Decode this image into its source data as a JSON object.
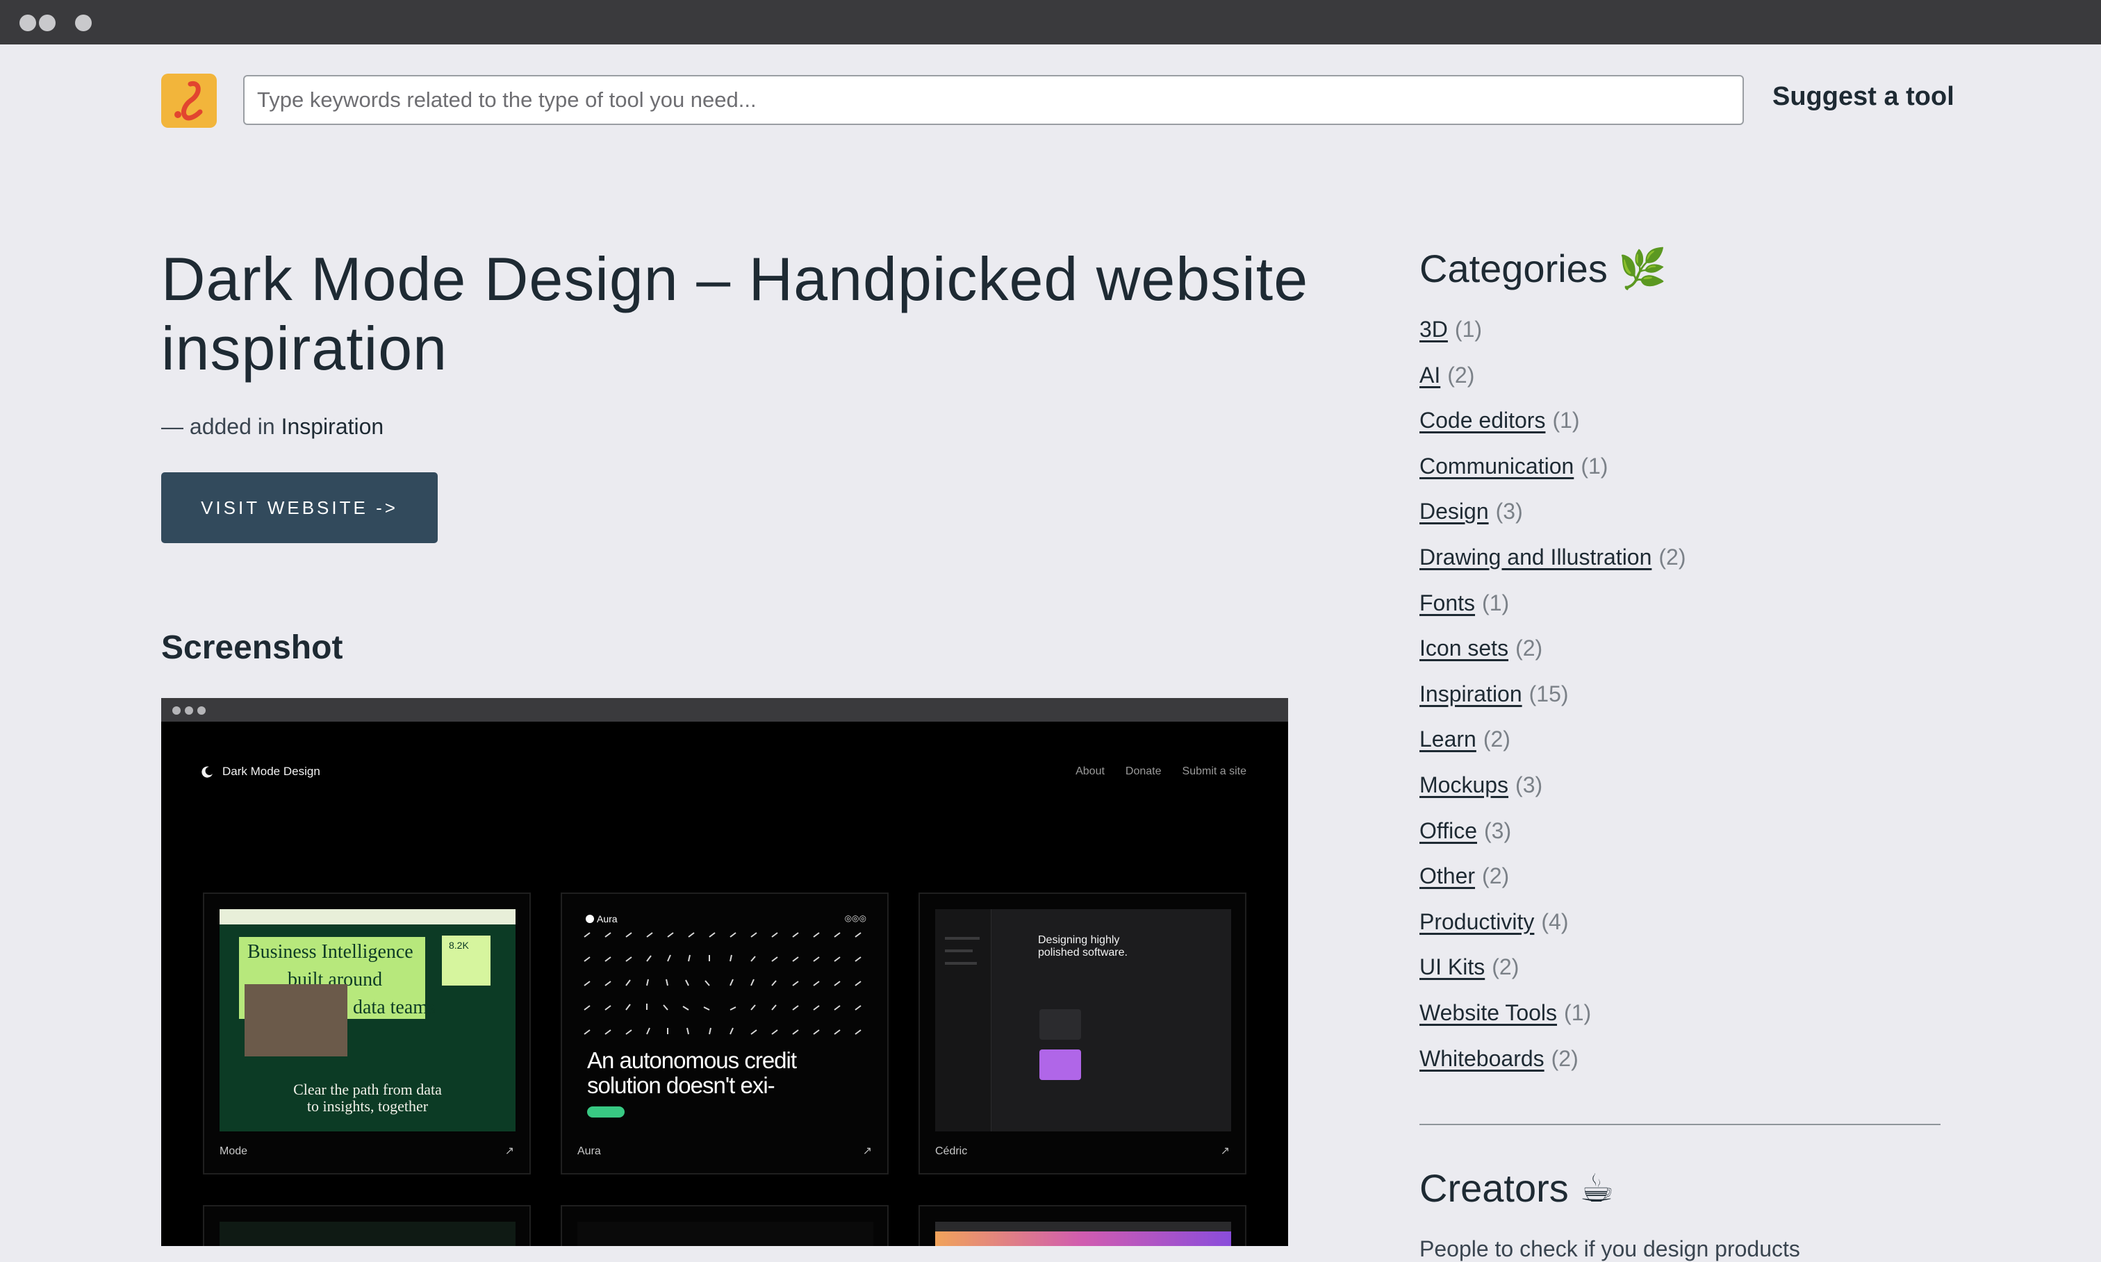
{
  "header": {
    "search_placeholder": "Type keywords related to the type of tool you need...",
    "suggest_label": "Suggest a tool"
  },
  "page": {
    "title": "Dark Mode Design – Handpicked website inspiration",
    "meta_prefix": "— added in",
    "meta_category": "Inspiration",
    "visit_label": "VISIT WEBSITE ->",
    "screenshot_heading": "Screenshot"
  },
  "screenshot": {
    "brand": "Dark Mode Design",
    "nav": [
      "About",
      "Donate",
      "Submit a site"
    ],
    "cards": [
      {
        "label": "Mode",
        "headline_lines": [
          "Business Intelligence",
          "built around",
          "data teams"
        ],
        "stat": "8.2K",
        "tagline_lines": [
          "Clear the path from data",
          "to insights, together"
        ]
      },
      {
        "label": "Aura",
        "brand": "Aura",
        "headline_lines": [
          "An autonomous credit",
          "solution doesn't exi-"
        ]
      },
      {
        "label": "Cédric",
        "headline_lines": [
          "Designing highly",
          "polished software."
        ]
      }
    ]
  },
  "sidebar": {
    "categories_title": "Categories 🌿",
    "categories": [
      {
        "name": "3D",
        "count": "(1)"
      },
      {
        "name": "AI",
        "count": "(2)"
      },
      {
        "name": "Code editors",
        "count": "(1)"
      },
      {
        "name": "Communication",
        "count": "(1)"
      },
      {
        "name": "Design",
        "count": "(3)"
      },
      {
        "name": "Drawing and Illustration",
        "count": "(2)"
      },
      {
        "name": "Fonts",
        "count": "(1)"
      },
      {
        "name": "Icon sets",
        "count": "(2)"
      },
      {
        "name": "Inspiration",
        "count": "(15)"
      },
      {
        "name": "Learn",
        "count": "(2)"
      },
      {
        "name": "Mockups",
        "count": "(3)"
      },
      {
        "name": "Office",
        "count": "(3)"
      },
      {
        "name": "Other",
        "count": "(2)"
      },
      {
        "name": "Productivity",
        "count": "(4)"
      },
      {
        "name": "UI Kits",
        "count": "(2)"
      },
      {
        "name": "Website Tools",
        "count": "(1)"
      },
      {
        "name": "Whiteboards",
        "count": "(2)"
      }
    ],
    "creators_title": "Creators ☕",
    "creators_text": "People to check if you design products"
  },
  "colors": {
    "background": "#ebebf0",
    "button": "#324a5c",
    "text": "#1e2a33",
    "logo": "#f2b53b"
  }
}
